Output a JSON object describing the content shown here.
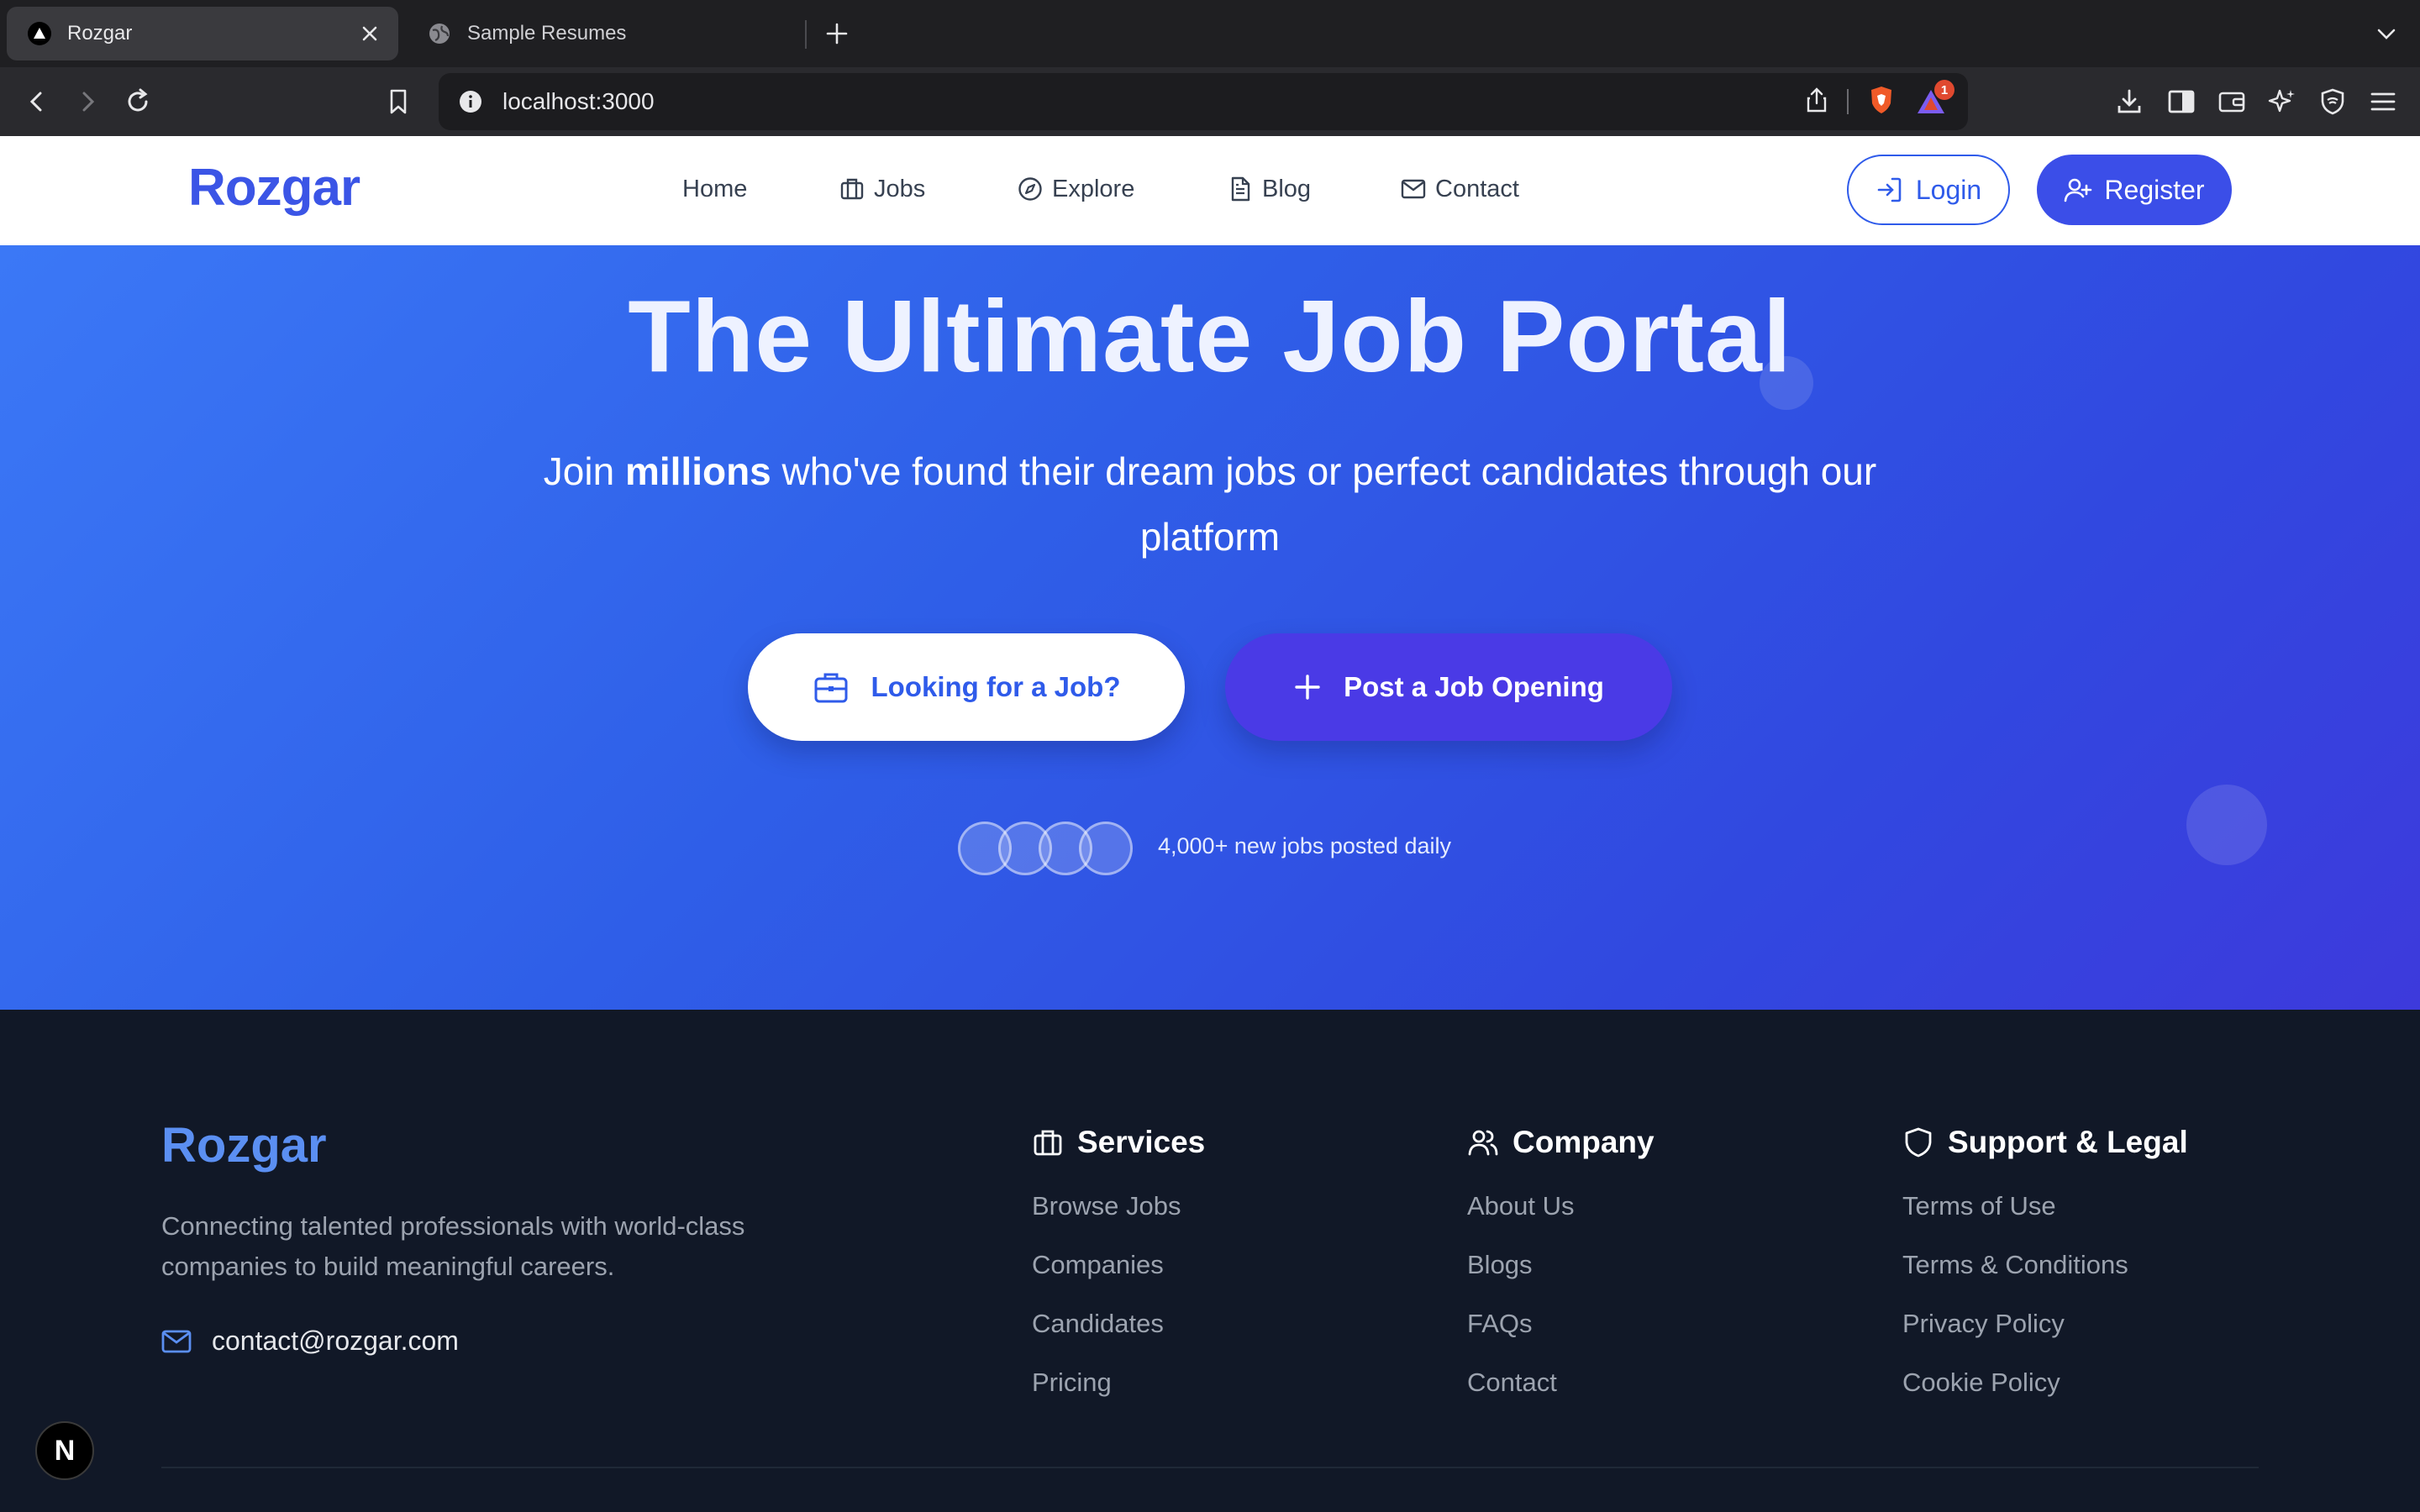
{
  "browser": {
    "tabs": [
      {
        "title": "Rozgar",
        "icon": "triangle-favicon",
        "active": true
      },
      {
        "title": "Sample Resumes",
        "icon": "globe-icon",
        "active": false
      }
    ],
    "url": "localhost:3000",
    "notification_count": "1"
  },
  "nav": {
    "brand": "Rozgar",
    "items": [
      {
        "label": "Home",
        "icon": ""
      },
      {
        "label": "Jobs",
        "icon": "briefcase-icon"
      },
      {
        "label": "Explore",
        "icon": "compass-icon"
      },
      {
        "label": "Blog",
        "icon": "document-icon"
      },
      {
        "label": "Contact",
        "icon": "mail-icon"
      }
    ],
    "login_label": "Login",
    "register_label": "Register"
  },
  "hero": {
    "title": "The Ultimate Job Portal",
    "subtitle_pre": "Join ",
    "subtitle_bold": "millions",
    "subtitle_post": " who've found their dream jobs or perfect candidates through our platform",
    "cta_primary": "Looking for a Job?",
    "cta_secondary": "Post a Job Opening",
    "stat": "4,000+ new jobs posted daily"
  },
  "footer": {
    "brand": "Rozgar",
    "tagline": "Connecting talented professionals with world-class companies to build meaningful careers.",
    "email": "contact@rozgar.com",
    "columns": [
      {
        "title": "Services",
        "icon": "briefcase-icon",
        "links": [
          "Browse Jobs",
          "Companies",
          "Candidates",
          "Pricing"
        ]
      },
      {
        "title": "Company",
        "icon": "users-icon",
        "links": [
          "About Us",
          "Blogs",
          "FAQs",
          "Contact"
        ]
      },
      {
        "title": "Support & Legal",
        "icon": "shield-icon",
        "links": [
          "Terms of Use",
          "Terms & Conditions",
          "Privacy Policy",
          "Cookie Policy"
        ]
      }
    ]
  },
  "dev_badge": "N",
  "colors": {
    "brand_blue": "#3b55e6",
    "hero_start": "#3b78f6",
    "hero_end": "#3d3adc",
    "footer_bg": "#111827",
    "footer_brand": "#5b8ff2"
  }
}
